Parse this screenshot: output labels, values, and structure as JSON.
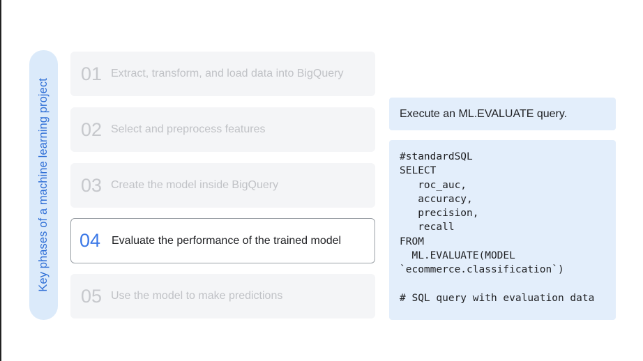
{
  "sidebar": {
    "title": "Key phases of a machine learning project"
  },
  "steps": [
    {
      "num": "01",
      "label": "Extract, transform, and load data into BigQuery",
      "active": false
    },
    {
      "num": "02",
      "label": "Select and preprocess features",
      "active": false
    },
    {
      "num": "03",
      "label": "Create the model inside BigQuery",
      "active": false
    },
    {
      "num": "04",
      "label": "Evaluate the performance of the trained model",
      "active": true
    },
    {
      "num": "05",
      "label": "Use the model to make predictions",
      "active": false
    }
  ],
  "instruction": "Execute an ML.EVALUATE query.",
  "code_lines": [
    "#standardSQL",
    "SELECT",
    "   roc_auc,",
    "   accuracy,",
    "   precision,",
    "   recall",
    "FROM",
    "  ML.EVALUATE(MODEL",
    "`ecommerce.classification`)",
    "",
    "# SQL query with evaluation data"
  ],
  "colors": {
    "accent": "#3b78e7",
    "pill_bg": "#dbeafa",
    "panel_bg": "#e3eefb"
  }
}
